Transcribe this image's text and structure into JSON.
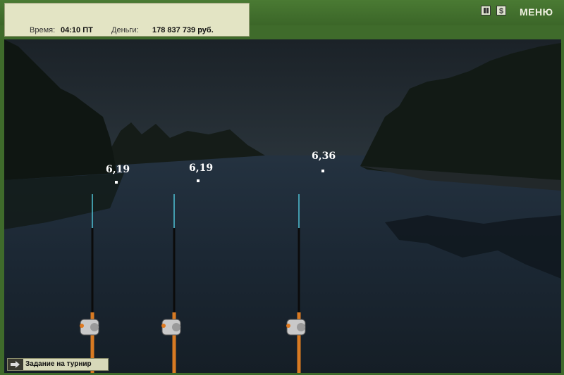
{
  "hud": {
    "time_label": "Время:",
    "time_value": "04:10 ПТ",
    "money_label": "Деньги:",
    "money_value": "178 837 739 руб.",
    "pause_icon": "pause-icon",
    "shop_label": "$",
    "menu_label": "МЕНЮ"
  },
  "rods": [
    {
      "depth": "6,19"
    },
    {
      "depth": "6,19"
    },
    {
      "depth": "6,36"
    }
  ],
  "task": {
    "icon": "arrow-right-icon",
    "label": "Задание на турнир"
  }
}
